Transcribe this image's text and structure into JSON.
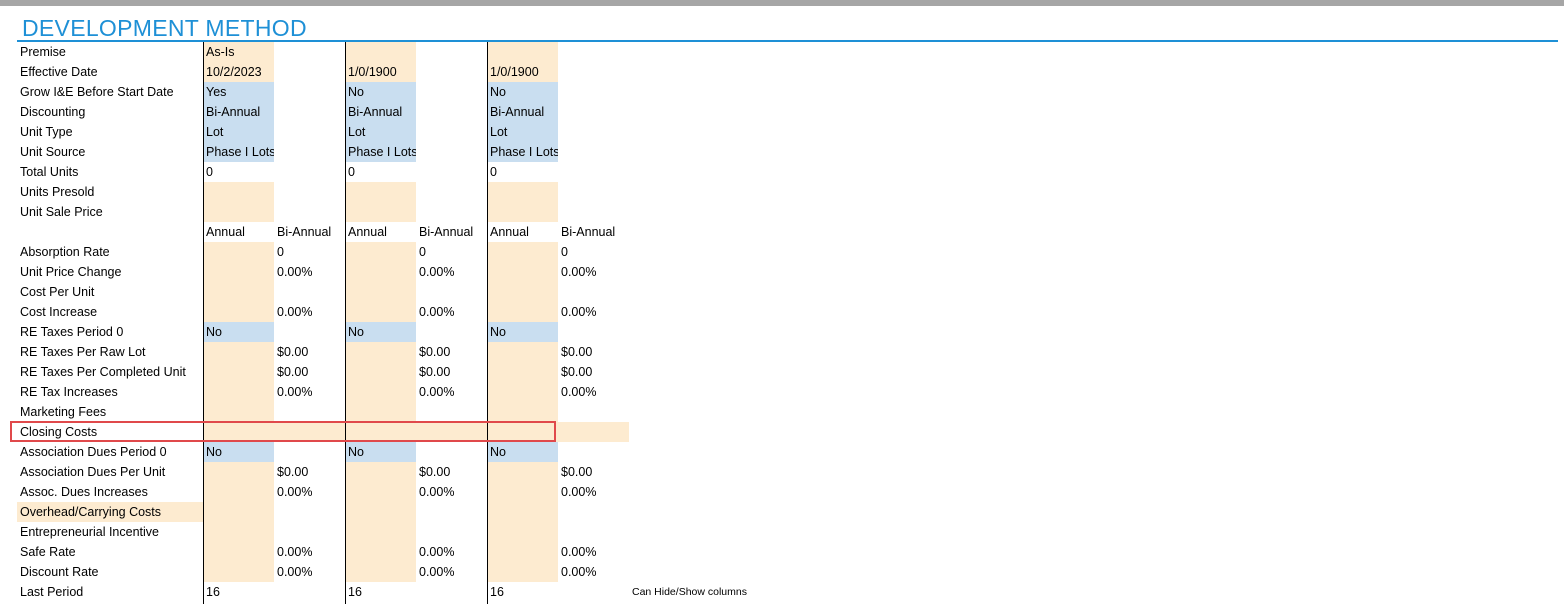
{
  "title": "DEVELOPMENT METHOD",
  "note": "Can Hide/Show columns",
  "colors": {
    "title": "#1e90d6",
    "input_tan": "#fdebd0",
    "input_blue": "#c9def0",
    "highlight": "#e0494b"
  },
  "rows": [
    {
      "label": "Premise",
      "cells": [
        "As-Is",
        "",
        "",
        "",
        "",
        ""
      ]
    },
    {
      "label": "Effective Date",
      "cells": [
        "10/2/2023",
        "",
        "1/0/1900",
        "",
        "1/0/1900",
        ""
      ]
    },
    {
      "label": "Grow I&E Before Start Date",
      "cells": [
        "Yes",
        "",
        "No",
        "",
        "No",
        ""
      ]
    },
    {
      "label": "Discounting",
      "cells": [
        "Bi-Annual",
        "",
        "Bi-Annual",
        "",
        "Bi-Annual",
        ""
      ]
    },
    {
      "label": "Unit Type",
      "cells": [
        "Lot",
        "",
        "Lot",
        "",
        "Lot",
        ""
      ]
    },
    {
      "label": "Unit Source",
      "cells": [
        "Phase I Lots",
        "",
        "Phase I Lots",
        "",
        "Phase I Lots",
        ""
      ]
    },
    {
      "label": "Total Units",
      "cells": [
        "0",
        "",
        "0",
        "",
        "0",
        ""
      ]
    },
    {
      "label": "Units Presold",
      "cells": [
        "",
        "",
        "",
        "",
        "",
        ""
      ]
    },
    {
      "label": "Unit Sale Price",
      "cells": [
        "",
        "",
        "",
        "",
        "",
        ""
      ]
    },
    {
      "label": "",
      "cells": [
        "Annual",
        "Bi-Annual",
        "Annual",
        "Bi-Annual",
        "Annual",
        "Bi-Annual"
      ]
    },
    {
      "label": "Absorption Rate",
      "cells": [
        "",
        "0",
        "",
        "0",
        "",
        "0"
      ]
    },
    {
      "label": "Unit Price Change",
      "cells": [
        "",
        "0.00%",
        "",
        "0.00%",
        "",
        "0.00%"
      ]
    },
    {
      "label": "Cost Per Unit",
      "cells": [
        "",
        "",
        "",
        "",
        "",
        ""
      ]
    },
    {
      "label": "Cost Increase",
      "cells": [
        "",
        "0.00%",
        "",
        "0.00%",
        "",
        "0.00%"
      ]
    },
    {
      "label": "RE Taxes Period 0",
      "cells": [
        "No",
        "",
        "No",
        "",
        "No",
        ""
      ]
    },
    {
      "label": "RE Taxes Per Raw Lot",
      "cells": [
        "",
        "$0.00",
        "",
        "$0.00",
        "",
        "$0.00"
      ]
    },
    {
      "label": "RE Taxes Per Completed Unit",
      "cells": [
        "",
        "$0.00",
        "",
        "$0.00",
        "",
        "$0.00"
      ]
    },
    {
      "label": "RE Tax Increases",
      "cells": [
        "",
        "0.00%",
        "",
        "0.00%",
        "",
        "0.00%"
      ]
    },
    {
      "label": "Marketing Fees",
      "cells": [
        "",
        "",
        "",
        "",
        "",
        ""
      ]
    },
    {
      "label": "Closing Costs",
      "cells": [
        "",
        "",
        "",
        "",
        "",
        ""
      ]
    },
    {
      "label": "Association Dues Period 0",
      "cells": [
        "No",
        "",
        "No",
        "",
        "No",
        ""
      ]
    },
    {
      "label": "Association Dues Per Unit",
      "cells": [
        "",
        "$0.00",
        "",
        "$0.00",
        "",
        "$0.00"
      ]
    },
    {
      "label": "Assoc. Dues Increases",
      "cells": [
        "",
        "0.00%",
        "",
        "0.00%",
        "",
        "0.00%"
      ]
    },
    {
      "label": "Overhead/Carrying Costs",
      "cells": [
        "",
        "",
        "",
        "",
        "",
        ""
      ]
    },
    {
      "label": "Entrepreneurial Incentive",
      "cells": [
        "",
        "",
        "",
        "",
        "",
        ""
      ]
    },
    {
      "label": "Safe Rate",
      "cells": [
        "",
        "0.00%",
        "",
        "0.00%",
        "",
        "0.00%"
      ]
    },
    {
      "label": "Discount Rate",
      "cells": [
        "",
        "0.00%",
        "",
        "0.00%",
        "",
        "0.00%"
      ]
    },
    {
      "label": "Last Period",
      "cells": [
        "16",
        "",
        "16",
        "",
        "16",
        ""
      ]
    }
  ]
}
